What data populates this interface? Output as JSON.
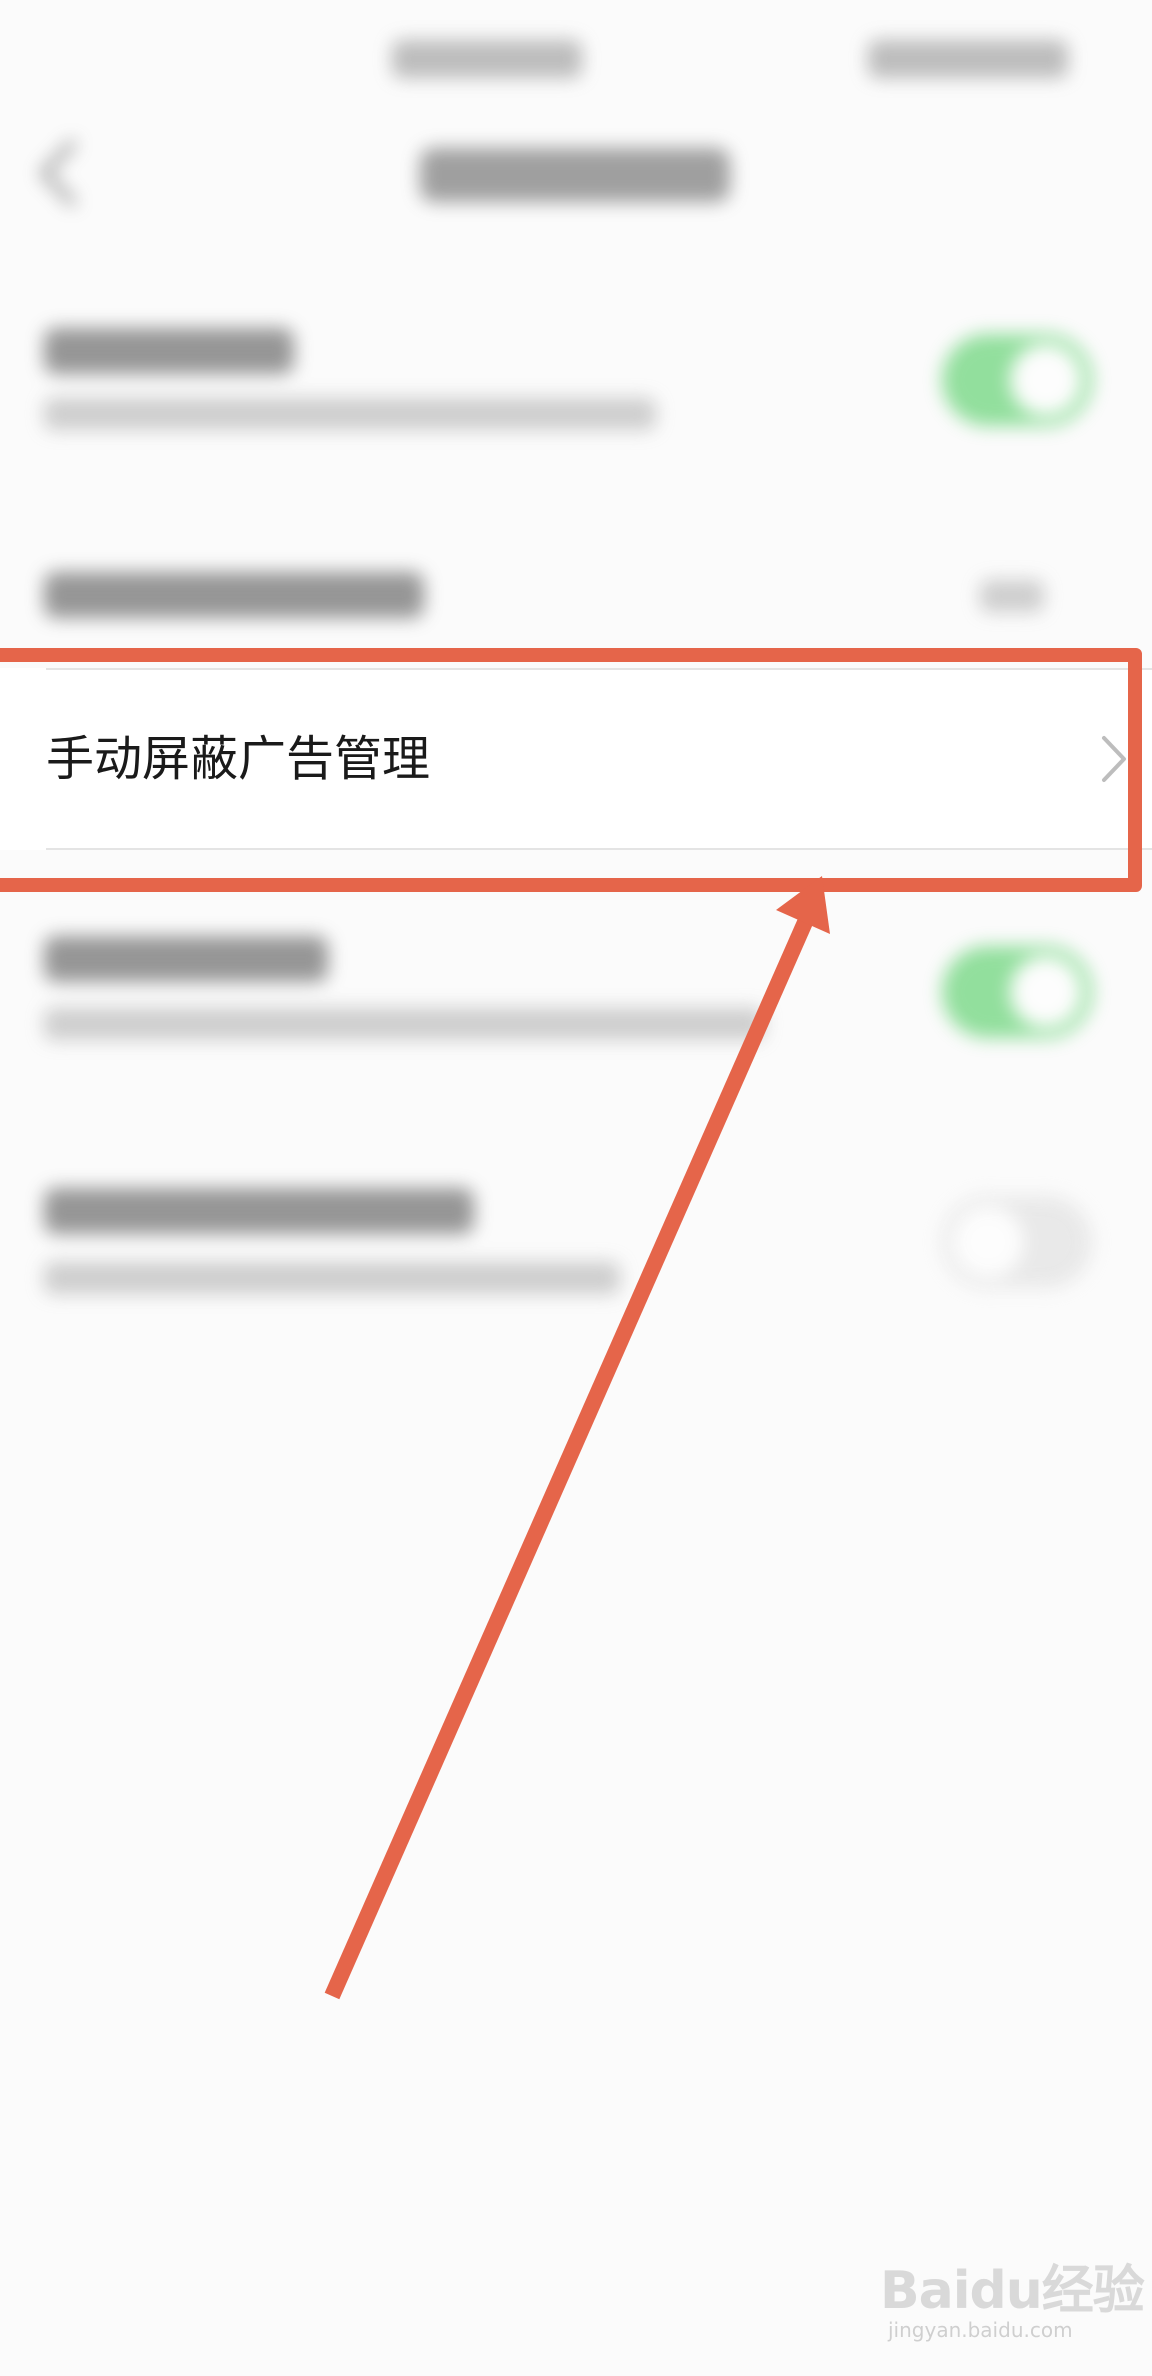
{
  "focused_row": {
    "label": "手动屏蔽广告管理"
  },
  "icons": {
    "back": "back-arrow-icon",
    "chevron": "chevron-right-icon"
  },
  "toggles": {
    "row1": "on",
    "row4": "on",
    "row5": "off"
  },
  "colors": {
    "annotation": "#e5654a",
    "toggle_on": "#3cc850",
    "toggle_off": "#dadada"
  },
  "watermark": {
    "logo": "Baidu经验",
    "url": "jingyan.baidu.com"
  }
}
